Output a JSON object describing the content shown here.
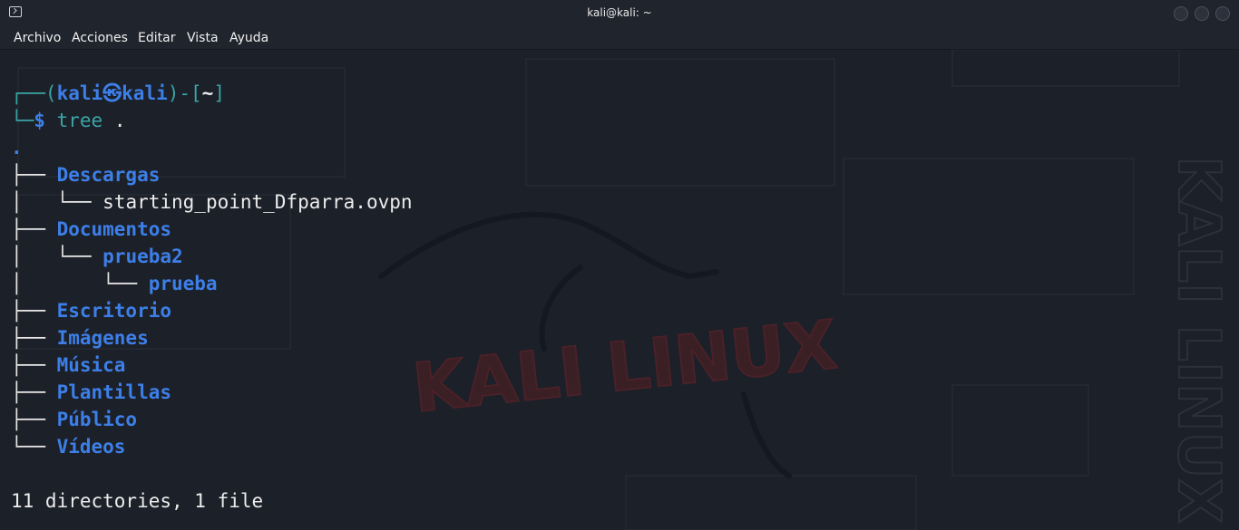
{
  "window": {
    "title": "kali@kali: ~"
  },
  "menu": [
    "Archivo",
    "Acciones",
    "Editar",
    "Vista",
    "Ayuda"
  ],
  "prompt": {
    "user": "kali",
    "host": "kali",
    "cwd": "~",
    "symbol": "$",
    "command": "tree",
    "args": "."
  },
  "tree": {
    "root": ".",
    "entries": [
      {
        "name": "Descargas",
        "type": "dir",
        "depth": 0
      },
      {
        "name": "starting_point_Dfparra.ovpn",
        "type": "file",
        "depth": 1
      },
      {
        "name": "Documentos",
        "type": "dir",
        "depth": 0
      },
      {
        "name": "prueba2",
        "type": "dir",
        "depth": 1
      },
      {
        "name": "prueba",
        "type": "dir",
        "depth": 2
      },
      {
        "name": "Escritorio",
        "type": "dir",
        "depth": 0
      },
      {
        "name": "Imágenes",
        "type": "dir",
        "depth": 0
      },
      {
        "name": "Música",
        "type": "dir",
        "depth": 0
      },
      {
        "name": "Plantillas",
        "type": "dir",
        "depth": 0
      },
      {
        "name": "Público",
        "type": "dir",
        "depth": 0
      },
      {
        "name": "Vídeos",
        "type": "dir",
        "depth": 0
      }
    ],
    "summary": "11 directories, 1 file"
  },
  "colors": {
    "prompt_frame": "#3aa5a5",
    "directory": "#3d7fe8",
    "text": "#ececec",
    "background": "#1c2028"
  },
  "wallpaper": {
    "logo_text": "KALI LINUX"
  }
}
